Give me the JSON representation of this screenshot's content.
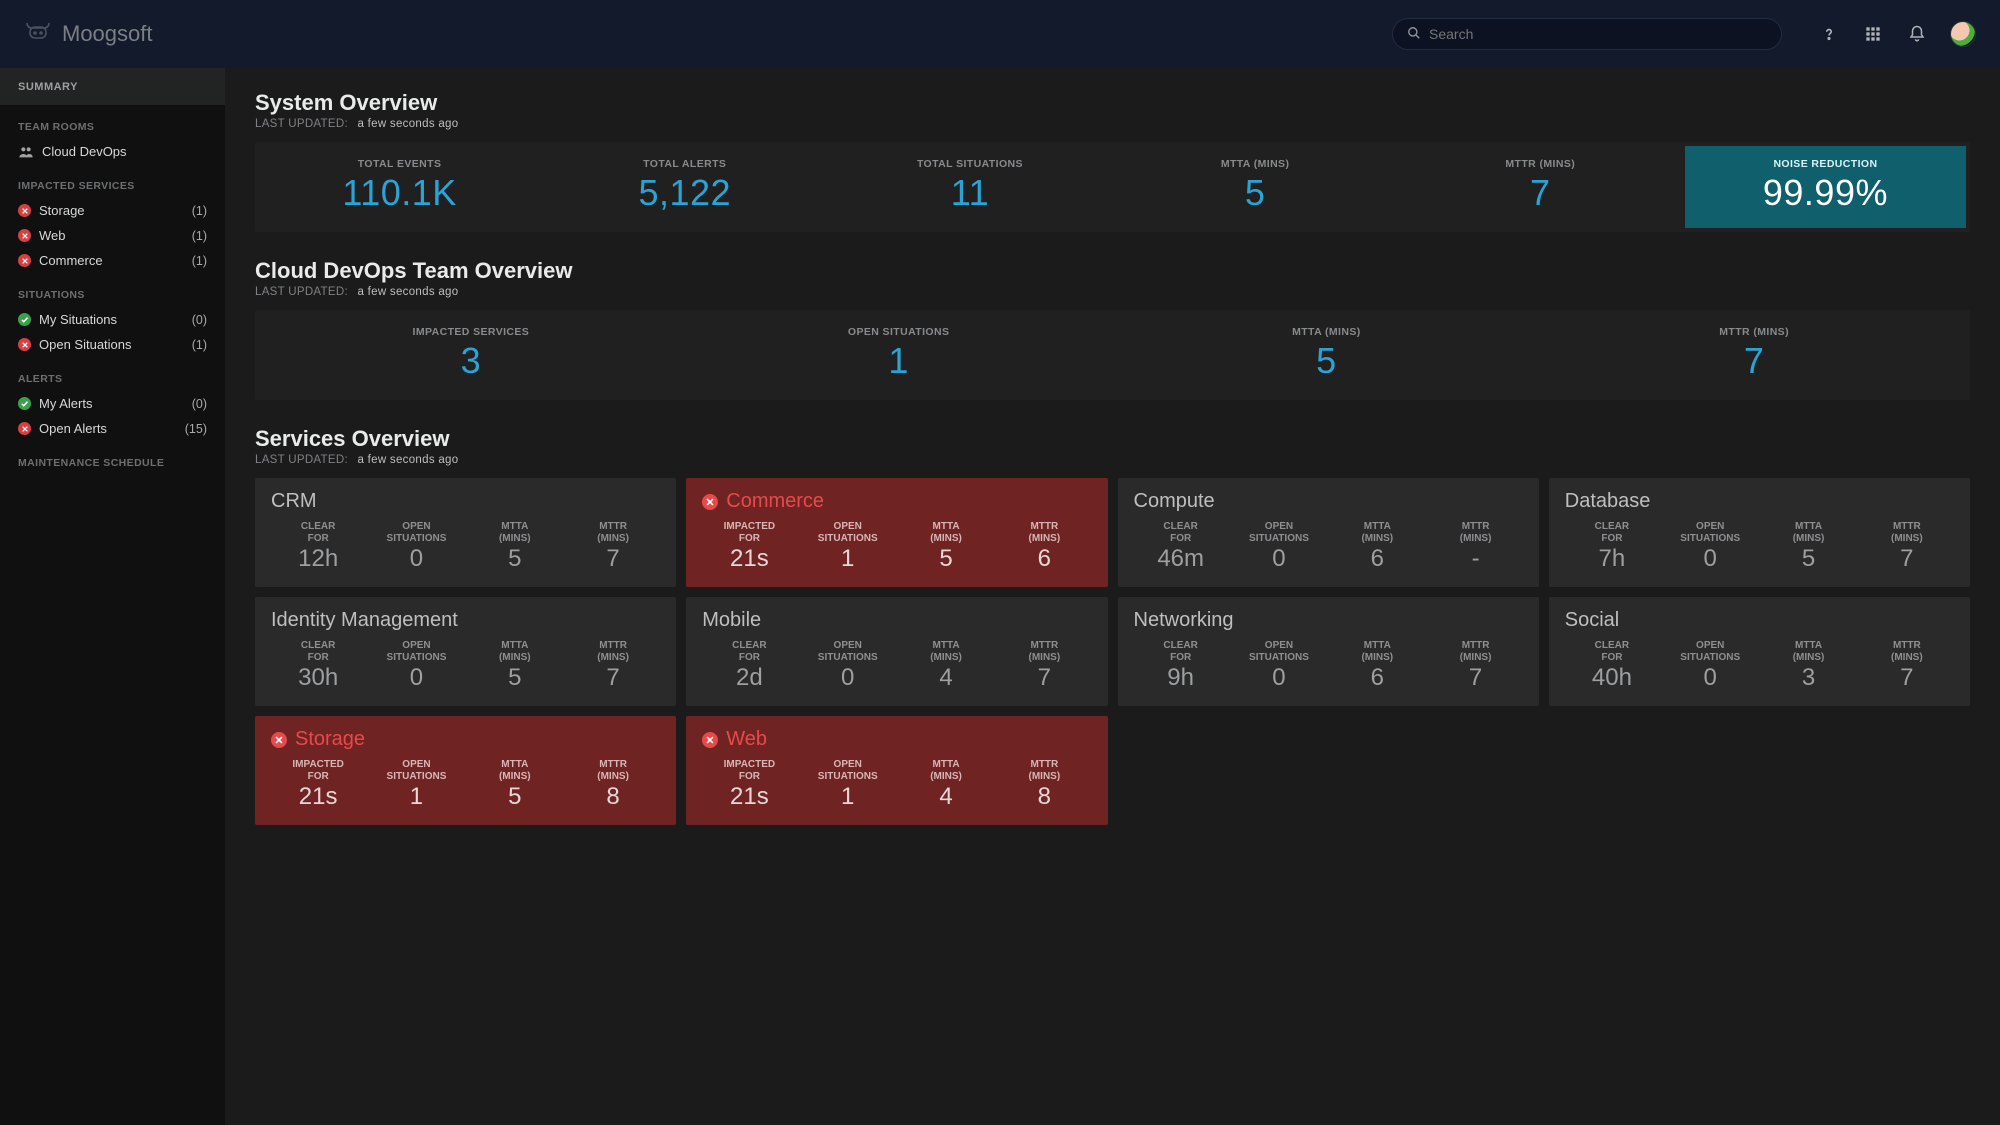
{
  "brand": "Moogsoft",
  "header": {
    "search_placeholder": "Search"
  },
  "sidebar": {
    "summary_label": "SUMMARY",
    "sections": {
      "team_rooms": {
        "title": "TEAM ROOMS",
        "items": [
          {
            "label": "Cloud DevOps"
          }
        ]
      },
      "impacted_services": {
        "title": "IMPACTED SERVICES",
        "items": [
          {
            "label": "Storage",
            "count": "(1)",
            "status": "red"
          },
          {
            "label": "Web",
            "count": "(1)",
            "status": "red"
          },
          {
            "label": "Commerce",
            "count": "(1)",
            "status": "red"
          }
        ]
      },
      "situations": {
        "title": "SITUATIONS",
        "items": [
          {
            "label": "My Situations",
            "count": "(0)",
            "status": "green"
          },
          {
            "label": "Open Situations",
            "count": "(1)",
            "status": "red"
          }
        ]
      },
      "alerts": {
        "title": "ALERTS",
        "items": [
          {
            "label": "My Alerts",
            "count": "(0)",
            "status": "green"
          },
          {
            "label": "Open Alerts",
            "count": "(15)",
            "status": "red"
          }
        ]
      },
      "maintenance": {
        "title": "MAINTENANCE SCHEDULE"
      }
    }
  },
  "system_overview": {
    "title": "System Overview",
    "lu_label": "LAST UPDATED:",
    "lu_value": "a few seconds ago",
    "metrics": [
      {
        "label": "TOTAL EVENTS",
        "value": "110.1K"
      },
      {
        "label": "TOTAL ALERTS",
        "value": "5,122"
      },
      {
        "label": "TOTAL SITUATIONS",
        "value": "11"
      },
      {
        "label": "MTTA (MINS)",
        "value": "5"
      },
      {
        "label": "MTTR (MINS)",
        "value": "7"
      },
      {
        "label": "NOISE REDUCTION",
        "value": "99.99%",
        "highlight": true
      }
    ]
  },
  "team_overview": {
    "title": "Cloud DevOps Team Overview",
    "lu_label": "LAST UPDATED:",
    "lu_value": "a few seconds ago",
    "metrics": [
      {
        "label": "IMPACTED SERVICES",
        "value": "3"
      },
      {
        "label": "OPEN SITUATIONS",
        "value": "1"
      },
      {
        "label": "MTTA (MINS)",
        "value": "5"
      },
      {
        "label": "MTTR (MINS)",
        "value": "7"
      }
    ]
  },
  "services_overview": {
    "title": "Services Overview",
    "lu_label": "LAST UPDATED:",
    "lu_value": "a few seconds ago",
    "stat_labels": {
      "clear_for": "CLEAR FOR",
      "impacted_for": "IMPACTED FOR",
      "open_situations": "OPEN SITUATIONS",
      "mtta": "MTTA (MINS)",
      "mttr": "MTTR (MINS)"
    },
    "services": [
      {
        "name": "CRM",
        "impacted": false,
        "clear_for": "12h",
        "open_situations": "0",
        "mtta": "5",
        "mttr": "7"
      },
      {
        "name": "Commerce",
        "impacted": true,
        "impacted_for": "21s",
        "open_situations": "1",
        "mtta": "5",
        "mttr": "6"
      },
      {
        "name": "Compute",
        "impacted": false,
        "clear_for": "46m",
        "open_situations": "0",
        "mtta": "6",
        "mttr": "-"
      },
      {
        "name": "Database",
        "impacted": false,
        "clear_for": "7h",
        "open_situations": "0",
        "mtta": "5",
        "mttr": "7"
      },
      {
        "name": "Identity Management",
        "impacted": false,
        "clear_for": "30h",
        "open_situations": "0",
        "mtta": "5",
        "mttr": "7"
      },
      {
        "name": "Mobile",
        "impacted": false,
        "clear_for": "2d",
        "open_situations": "0",
        "mtta": "4",
        "mttr": "7"
      },
      {
        "name": "Networking",
        "impacted": false,
        "clear_for": "9h",
        "open_situations": "0",
        "mtta": "6",
        "mttr": "7"
      },
      {
        "name": "Social",
        "impacted": false,
        "clear_for": "40h",
        "open_situations": "0",
        "mtta": "3",
        "mttr": "7"
      },
      {
        "name": "Storage",
        "impacted": true,
        "impacted_for": "21s",
        "open_situations": "1",
        "mtta": "5",
        "mttr": "8"
      },
      {
        "name": "Web",
        "impacted": true,
        "impacted_for": "21s",
        "open_situations": "1",
        "mtta": "4",
        "mttr": "8"
      }
    ]
  }
}
